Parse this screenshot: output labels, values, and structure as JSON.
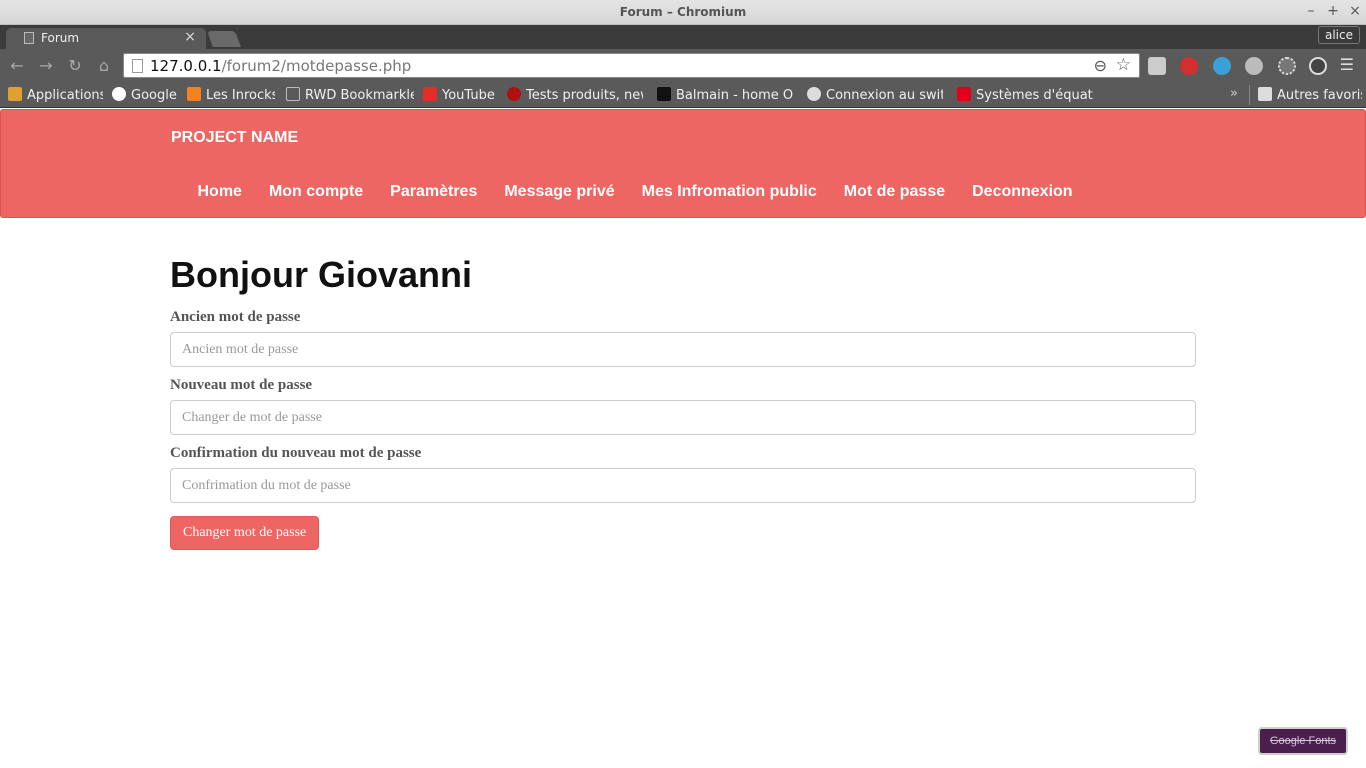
{
  "window": {
    "title": "Forum – Chromium",
    "user": "alice",
    "controls": {
      "minimize": "–",
      "maximize": "+",
      "close": "×"
    }
  },
  "tab": {
    "label": "Forum",
    "close": "×"
  },
  "toolbar": {
    "url_host": "127.0.0.1",
    "url_path": "/forum2/motdepasse.php",
    "back": "←",
    "forward": "→",
    "reload": "↻",
    "home": "⌂",
    "zoom": "⊖",
    "star": "☆",
    "menu": "☰"
  },
  "bookmarks": {
    "items": [
      {
        "label": "Applications",
        "color": "#e0a030"
      },
      {
        "label": "Google",
        "color": "#ffffff"
      },
      {
        "label": "Les Inrocks",
        "color": "#f58220"
      },
      {
        "label": "RWD Bookmarklet",
        "color": "#bbbbbb"
      },
      {
        "label": "YouTube",
        "color": "#e52d27"
      },
      {
        "label": "Tests produits, new",
        "color": "#b01010"
      },
      {
        "label": "Balmain - home On",
        "color": "#111111"
      },
      {
        "label": "Connexion au switc",
        "color": "#dddddd"
      },
      {
        "label": "Systèmes d'équatio",
        "color": "#e2001a"
      }
    ],
    "more": "»",
    "other": "Autres favoris"
  },
  "header": {
    "brand": "PROJECT NAME",
    "nav": [
      "Home",
      "Mon compte",
      "Paramètres",
      "Message privé",
      "Mes Infromation public",
      "Mot de passe",
      "Deconnexion"
    ]
  },
  "main": {
    "heading": "Bonjour Giovanni",
    "fields": [
      {
        "label": "Ancien mot de passe",
        "placeholder": "Ancien mot de passe"
      },
      {
        "label": "Nouveau mot de passe",
        "placeholder": "Changer de mot de passe"
      },
      {
        "label": "Confirmation du nouveau mot de passe",
        "placeholder": "Confrimation du mot de passe"
      }
    ],
    "submit": "Changer mot de passe"
  },
  "badge": {
    "label": "Google Fonts"
  },
  "colors": {
    "accent": "#ed6663",
    "chrome_dark": "#3b3b3b",
    "chrome": "#5a5a5a"
  }
}
